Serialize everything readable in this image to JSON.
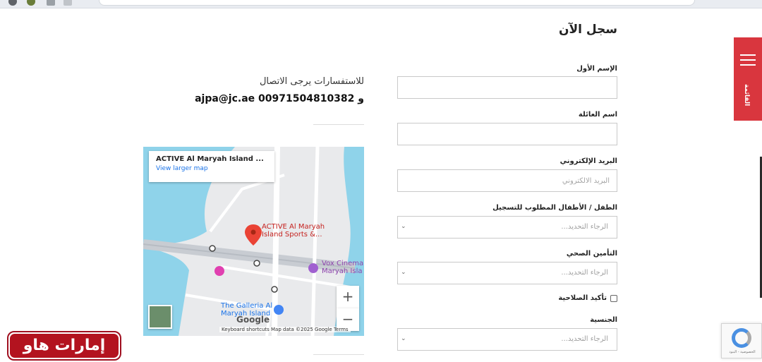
{
  "form": {
    "title": "سجل الآن",
    "first_name_label": "الإسم الأول",
    "last_name_label": "اسم العائلة",
    "email_label": "البريد الإلكتروني",
    "email_placeholder": "البريد الالكتروني",
    "children_label": "الطفل / الأطفال المطلوب للتسجيل",
    "children_value": "الرجاء التحديد...",
    "insurance_label": "التأمين الصحي",
    "insurance_value": "الرجاء التحديد...",
    "validity_label": "تأكيد الصلاحية",
    "nationality_label": "الجنسية",
    "nationality_value": "الرجاء التحديد..."
  },
  "contact": {
    "line1": "للاستفسارات يرجى الاتصال",
    "line2": "ajpa@jc.ae و 00971504810382"
  },
  "map": {
    "place_title": "ACTIVE Al Maryah Island ...",
    "larger_map_link": "View larger map",
    "pin_label_1": "ACTIVE Al Maryah",
    "pin_label_2": "Island Sports &...",
    "vox_label_1": "Vox Cinema",
    "vox_label_2": "Maryah Isla",
    "galleria_label_1": "The Galleria Al",
    "galleria_label_2": "Maryah Island",
    "zoom_in": "+",
    "zoom_out": "−",
    "google_logo": "Google",
    "footer": "Keyboard shortcuts    Map data ©2025 Google    Terms"
  },
  "side_tab": {
    "label": "القائمة"
  },
  "recaptcha": {
    "text": "الخصوصية - البنود"
  },
  "brand": {
    "name": "إمارات هاو"
  },
  "colors": {
    "accent_red": "#d9363e",
    "brand_red": "#b3131f",
    "link_blue": "#1a73e8"
  }
}
